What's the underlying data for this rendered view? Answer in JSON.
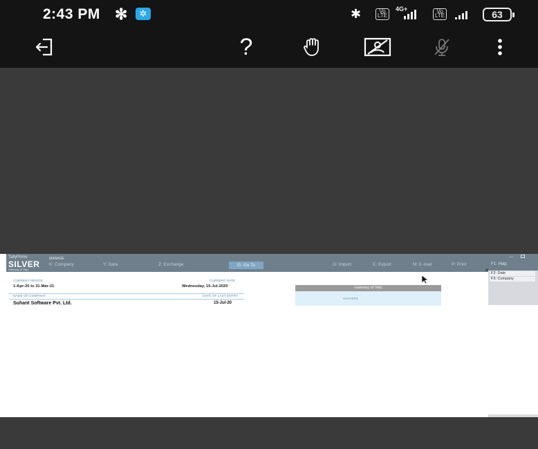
{
  "status_bar": {
    "time": "2:43 PM",
    "battery": "63",
    "network_left": "4G+",
    "network_badge_top": "Vo",
    "network_badge_bottom": "LTE"
  },
  "toolbar": {
    "icons": [
      "exit-icon",
      "help-icon",
      "raise-hand-icon",
      "camera-off-icon",
      "mic-off-icon",
      "more-vert-icon"
    ],
    "help_glyph": "?"
  },
  "shared_screen": {
    "brand": "TallyPrime",
    "edition": "SILVER",
    "tagline": "Gateway of Tally",
    "manage_label": "MANAGE",
    "menu": {
      "company": "K: Company",
      "data": "Y: Data",
      "exchange": "Z: Exchange",
      "goto": "G: Go To",
      "import": "O: Import",
      "export": "E: Export",
      "email": "M: E-mail",
      "print": "P: Print",
      "help": "F1: Help"
    },
    "right_panel_items": [
      "F2: Date",
      "F3: Company"
    ],
    "current_period_label": "CURRENT PERIOD",
    "current_period": "1-Apr-20 to 31-Mar-21",
    "current_date_label": "CURRENT DATE",
    "current_date": "Wednesday, 15-Jul-2020",
    "name_of_company_label": "NAME OF COMPANY",
    "date_of_last_entry_label": "DATE OF LAST ENTRY",
    "company_name": "Suhant Software Pvt. Ltd.",
    "last_entry_date": "15-Jul-20",
    "gateway_title": "Gateway of Tally",
    "gateway_first_item": "MASTERS"
  },
  "colors": {
    "status_bg": "#141414",
    "call_bg": "#3a3a3a",
    "tally_header": "#6f7f8c",
    "gateway_box": "#dff0fa"
  }
}
